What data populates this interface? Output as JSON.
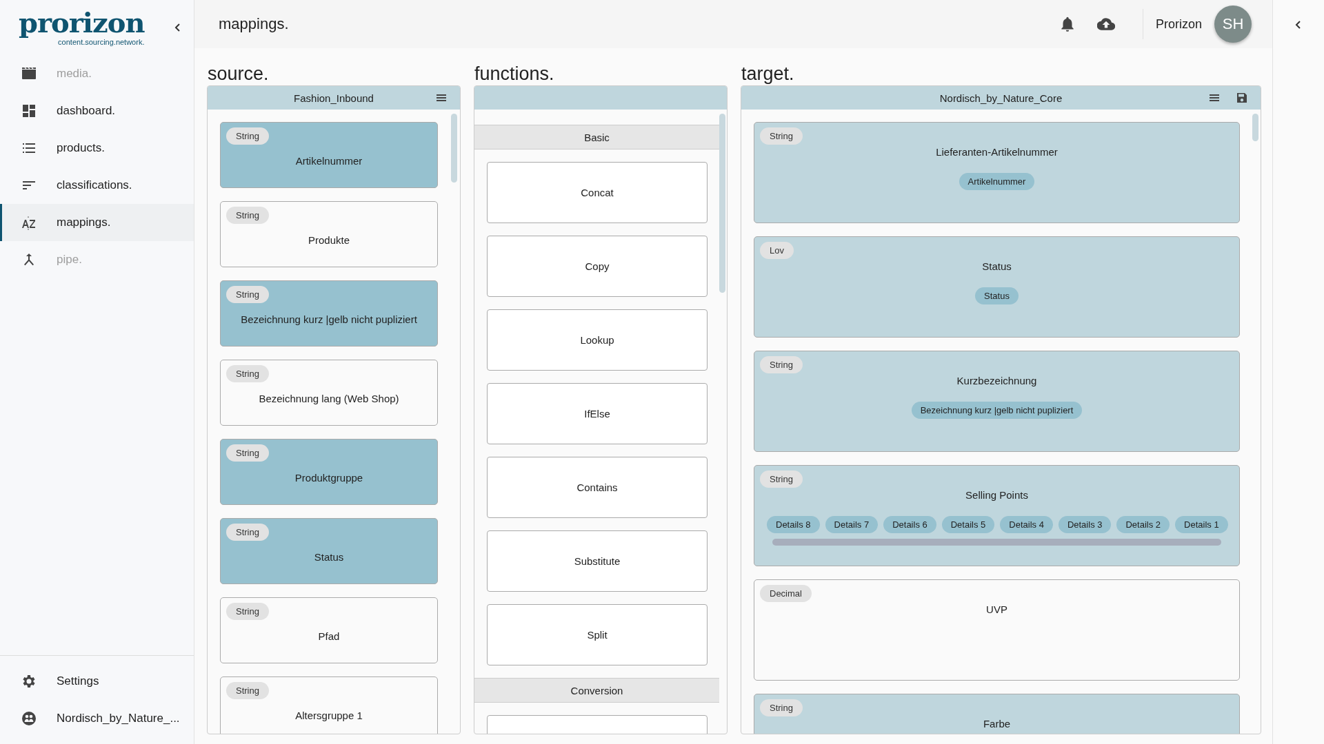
{
  "sidebar": {
    "logo": {
      "name": "prorizon",
      "tagline": "content.sourcing.network."
    },
    "items": [
      {
        "label": "media.",
        "kind": "clapper",
        "selected": false,
        "disabled": true
      },
      {
        "label": "dashboard.",
        "kind": "dashboard",
        "selected": false,
        "disabled": false
      },
      {
        "label": "products.",
        "kind": "list",
        "selected": false,
        "disabled": false
      },
      {
        "label": "classifications.",
        "kind": "sort",
        "selected": false,
        "disabled": false
      },
      {
        "label": "mappings.",
        "kind": "az",
        "selected": true,
        "disabled": false
      },
      {
        "label": "pipe.",
        "kind": "merge",
        "selected": false,
        "disabled": true
      }
    ],
    "bottom_items": [
      {
        "label": "Settings",
        "kind": "gear"
      },
      {
        "label": "Nordisch_by_Nature_...",
        "kind": "group"
      }
    ]
  },
  "header": {
    "title": "mappings.",
    "user": "Prorizon",
    "avatar": "SH"
  },
  "source": {
    "title": "source.",
    "panel_title": "Fashion_Inbound",
    "fields": [
      {
        "type": "String",
        "name": "Artikelnummer",
        "mapped": true
      },
      {
        "type": "String",
        "name": "Produkte",
        "mapped": false
      },
      {
        "type": "String",
        "name": "Bezeichnung kurz |gelb nicht pupliziert",
        "mapped": true
      },
      {
        "type": "String",
        "name": "Bezeichnung lang (Web Shop)",
        "mapped": false
      },
      {
        "type": "String",
        "name": "Produktgruppe",
        "mapped": true
      },
      {
        "type": "String",
        "name": "Status",
        "mapped": true
      },
      {
        "type": "String",
        "name": "Pfad",
        "mapped": false
      },
      {
        "type": "String",
        "name": "Altersgruppe 1",
        "mapped": false
      }
    ]
  },
  "functions": {
    "title": "functions.",
    "groups": [
      {
        "name": "Basic",
        "items": [
          "Concat",
          "Copy",
          "Lookup",
          "IfElse",
          "Contains",
          "Substitute",
          "Split"
        ]
      },
      {
        "name": "Conversion"
      }
    ]
  },
  "target": {
    "title": "target.",
    "panel_title": "Nordisch_by_Nature_Core",
    "fields": [
      {
        "type": "String",
        "name": "Lieferanten-Artikelnummer",
        "mapped": true,
        "sources": [
          "Artikelnummer"
        ]
      },
      {
        "type": "Lov",
        "name": "Status",
        "mapped": true,
        "sources": [
          "Status"
        ]
      },
      {
        "type": "String",
        "name": "Kurzbezeichnung",
        "mapped": true,
        "sources": [
          "Bezeichnung kurz |gelb nicht pupliziert"
        ]
      },
      {
        "type": "String",
        "name": "Selling Points",
        "mapped": true,
        "sources": [
          "Details 8",
          "Details 7",
          "Details 6",
          "Details 5",
          "Details 4",
          "Details 3",
          "Details 2",
          "Details 1"
        ]
      },
      {
        "type": "Decimal",
        "name": "UVP",
        "mapped": false
      },
      {
        "type": "String",
        "name": "Farbe",
        "mapped": true
      }
    ]
  }
}
